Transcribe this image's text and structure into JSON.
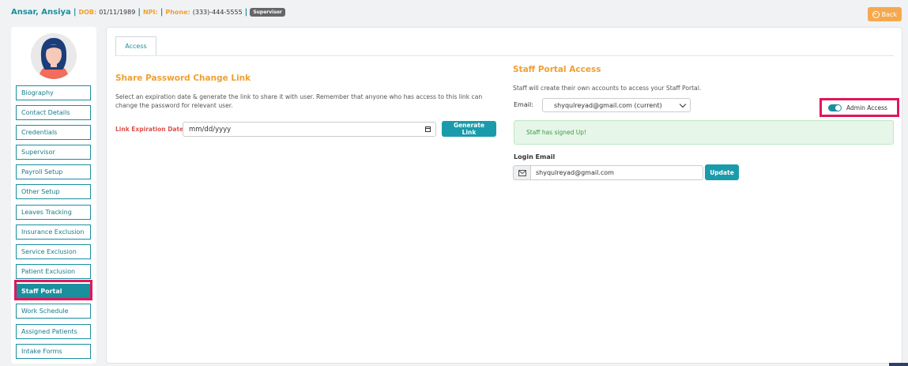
{
  "header": {
    "name": "Ansar, Ansiya",
    "dob_label": "DOB:",
    "dob": "01/11/1989",
    "npi_label": "NPI:",
    "phone_label": "Phone:",
    "phone": "(333)-444-5555",
    "role_badge": "Supervisor",
    "back_label": "Back"
  },
  "sidebar": {
    "items": [
      {
        "label": "Biography"
      },
      {
        "label": "Contact Details"
      },
      {
        "label": "Credentials"
      },
      {
        "label": "Supervisor"
      },
      {
        "label": "Payroll Setup"
      },
      {
        "label": "Other Setup"
      },
      {
        "label": "Leaves Tracking"
      },
      {
        "label": "Insurance Exclusion"
      },
      {
        "label": "Service Exclusion"
      },
      {
        "label": "Patient Exclusion"
      },
      {
        "label": "Staff Portal",
        "active": true
      },
      {
        "label": "Work Schedule"
      },
      {
        "label": "Assigned Patients"
      },
      {
        "label": "Intake Forms"
      }
    ]
  },
  "tabs": [
    {
      "label": "Access",
      "active": true
    }
  ],
  "share": {
    "title": "Share Password Change Link",
    "description": "Select an expiration date & generate the link to share it with user. Remember that anyone who has access to this link can change the password for relevant user.",
    "expiration_label": "Link Expiration Date",
    "date_placeholder": "mm/dd/yyyy",
    "generate_label": "Generate Link"
  },
  "portal": {
    "title": "Staff Portal Access",
    "description": "Staff will create their own accounts to access your Staff Portal.",
    "email_label": "Email:",
    "email_selected": "shyqulreyad@gmail.com (current)",
    "admin_access_label": "Admin Access",
    "admin_access_on": true,
    "status_message": "Staff has signed Up!",
    "login_email_label": "Login Email",
    "login_email_value": "shyqulreyad@gmail.com",
    "update_label": "Update"
  },
  "colors": {
    "teal": "#1a8f9e",
    "orange": "#f0a030",
    "highlight": "#e0175a",
    "success_bg": "#e6f6e8"
  }
}
